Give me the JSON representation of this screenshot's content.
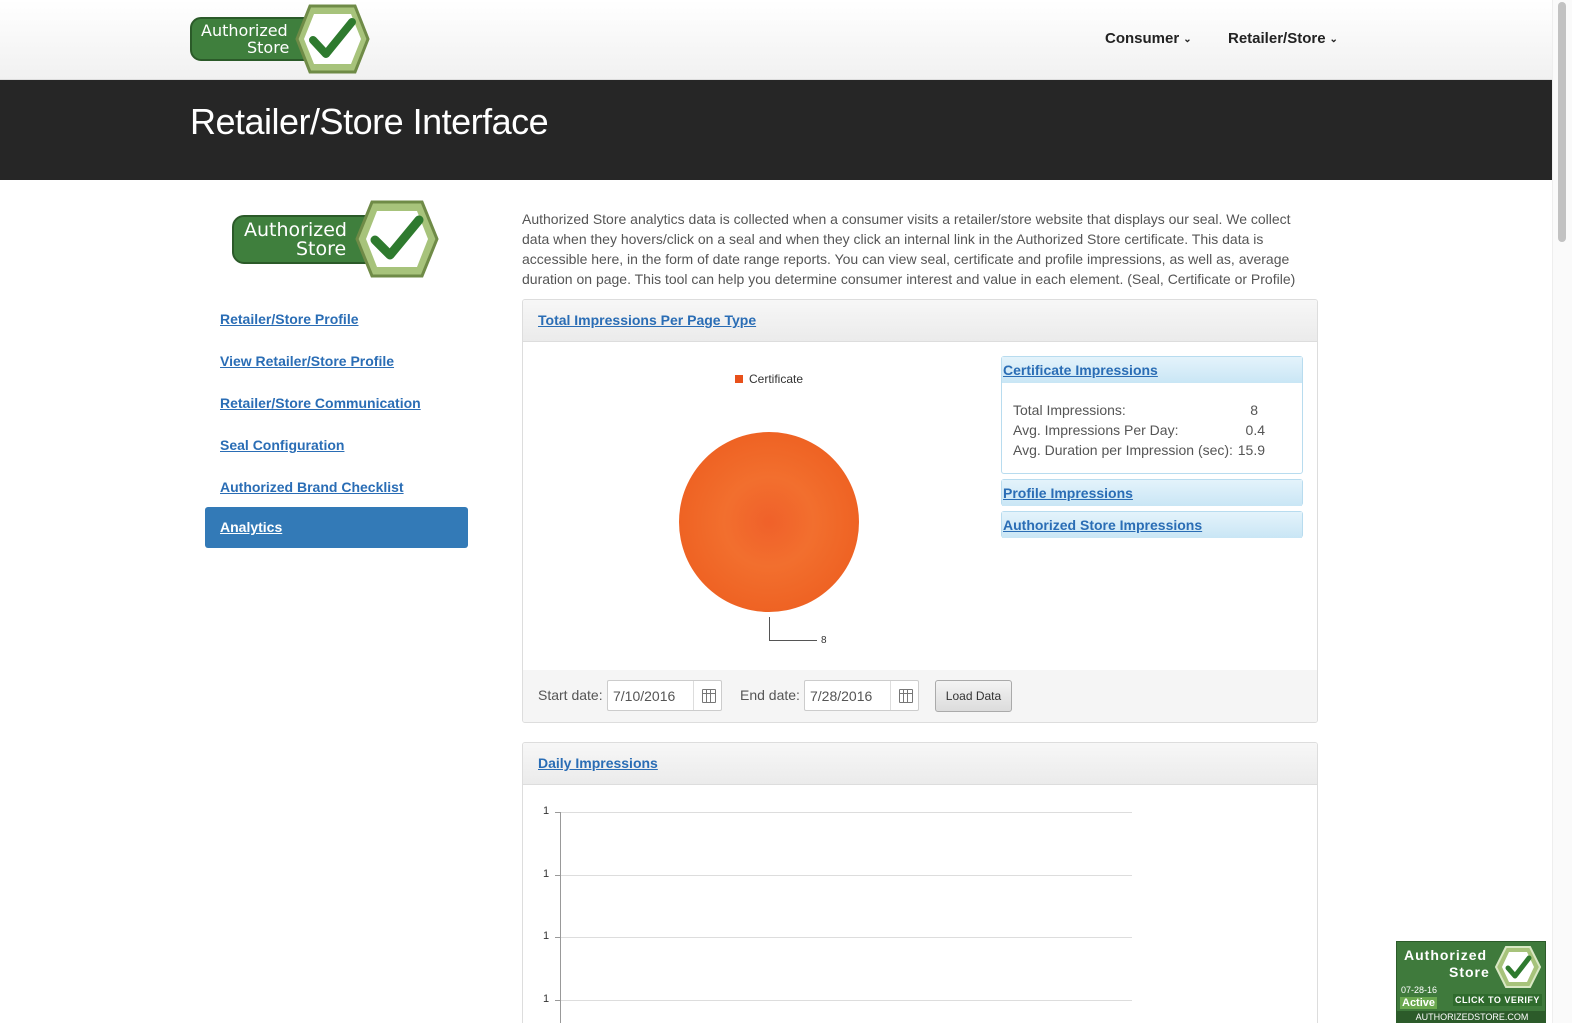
{
  "header": {
    "logo_line1": "Authorized",
    "logo_line2": "Store",
    "nav": [
      {
        "label": "Consumer"
      },
      {
        "label": "Retailer/Store"
      }
    ]
  },
  "banner": {
    "title": "Retailer/Store Interface"
  },
  "sidebar": {
    "items": [
      {
        "label": "Retailer/Store Profile"
      },
      {
        "label": "View Retailer/Store Profile"
      },
      {
        "label": "Retailer/Store Communication"
      },
      {
        "label": "Seal Configuration"
      },
      {
        "label": "Authorized Brand Checklist"
      },
      {
        "label": "Analytics",
        "active": true
      }
    ]
  },
  "intro": "Authorized Store analytics data is collected when a consumer visits a retailer/store website that displays our seal. We collect data when they hovers/click on a seal and when they click an internal link in the Authorized Store certificate. This data is accessible here, in the form of date range reports. You can view seal, certificate and profile impressions, as well as, average duration on page. This tool can help you determine consumer interest and value in each element. (Seal, Certificate or Profile)",
  "impressions_panel": {
    "title": "Total Impressions Per Page Type",
    "accordion": [
      {
        "title": "Certificate Impressions",
        "stats": [
          {
            "label": "Total Impressions:",
            "value": "8"
          },
          {
            "label": "Avg. Impressions Per Day:",
            "value": "0.4"
          },
          {
            "label": "Avg. Duration per Impression (sec):",
            "value": "15.9"
          }
        ]
      },
      {
        "title": "Profile Impressions"
      },
      {
        "title": "Authorized Store Impressions"
      }
    ],
    "start_label": "Start date:",
    "start_value": "7/10/2016",
    "end_label": "End date:",
    "end_value": "7/28/2016",
    "load_button": "Load Data"
  },
  "daily_panel": {
    "title": "Daily Impressions"
  },
  "chart_data": [
    {
      "type": "pie",
      "categories": [
        "Certificate"
      ],
      "values": [
        8
      ],
      "legend": "top",
      "colors": [
        "#e8501a"
      ]
    },
    {
      "type": "line",
      "title": "",
      "y_tick_labels": [
        "1",
        "1",
        "1",
        "1"
      ],
      "series": [],
      "grid": true
    }
  ],
  "badge": {
    "line1": "Authorized",
    "line2": "Store",
    "date": "07-28-16",
    "status": "Active",
    "cta": "CLICK TO VERIFY",
    "url": "AUTHORIZEDSTORE.COM"
  },
  "colors": {
    "accent": "#337ab7",
    "link": "#2a6db5",
    "banner": "#262626",
    "pie": "#e8501a",
    "brand_green": "#3f7a3c"
  }
}
